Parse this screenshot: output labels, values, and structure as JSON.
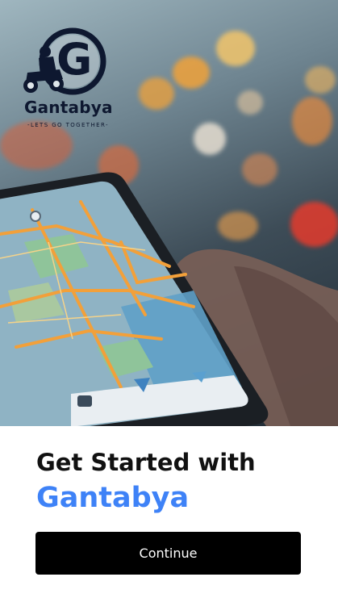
{
  "app": {
    "logo_letter": "G",
    "brand_name": "Gantabya",
    "tagline": "LETS GO TOGETHER"
  },
  "welcome": {
    "title_line1": "Get Started with",
    "title_line2": "Gantabya"
  },
  "actions": {
    "continue_label": "Continue"
  },
  "colors": {
    "brand_blue": "#3e82f7",
    "button_bg": "#000000",
    "logo_navy": "#0e1830"
  },
  "icons": {
    "logo": "rider-on-atv-logo-icon",
    "phone": "smartphone-map-illustration"
  }
}
